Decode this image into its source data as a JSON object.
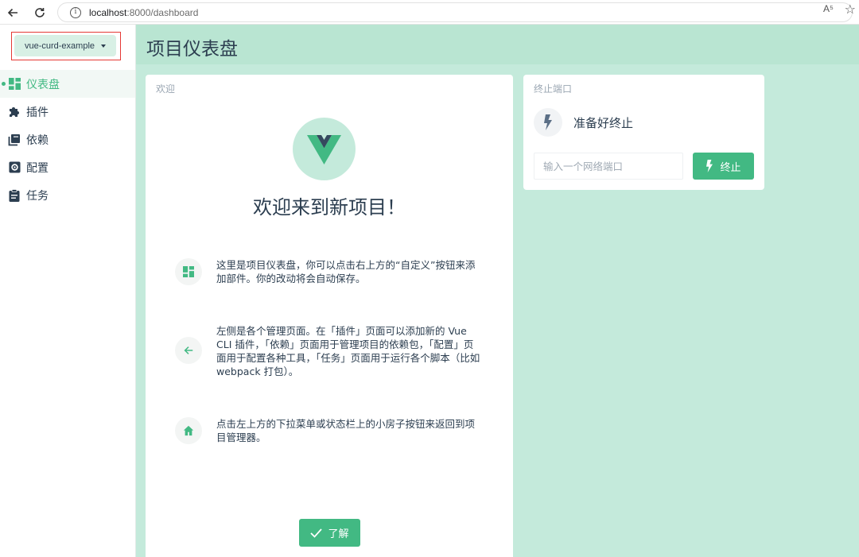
{
  "browser": {
    "url_host": "localhost",
    "url_rest": ":8000/dashboard",
    "read_aloud_label": "A⁵"
  },
  "sidebar": {
    "project_name": "vue-curd-example",
    "items": [
      {
        "label": "仪表盘",
        "icon": "dashboard-icon",
        "active": true
      },
      {
        "label": "插件",
        "icon": "puzzle-icon",
        "active": false
      },
      {
        "label": "依赖",
        "icon": "library-icon",
        "active": false
      },
      {
        "label": "配置",
        "icon": "settings-box-icon",
        "active": false
      },
      {
        "label": "任务",
        "icon": "clipboard-icon",
        "active": false
      }
    ]
  },
  "header": {
    "title": "项目仪表盘"
  },
  "welcome": {
    "card_title": "欢迎",
    "heading": "欢迎来到新项目！",
    "tips": [
      {
        "icon": "dashboard-icon",
        "text": "这里是项目仪表盘，你可以点击右上方的“自定义”按钮来添加部件。你的改动将会自动保存。"
      },
      {
        "icon": "arrow-left-icon",
        "text": "左侧是各个管理页面。在「插件」页面可以添加新的 Vue CLI 插件，「依赖」页面用于管理项目的依赖包，「配置」页面用于配置各种工具，「任务」页面用于运行各个脚本（比如 webpack 打包）。"
      },
      {
        "icon": "home-icon",
        "text": "点击左上方的下拉菜单或状态栏上的小房子按钮来返回到项目管理器。"
      }
    ],
    "ok_label": "了解"
  },
  "kill_port": {
    "card_title": "终止端口",
    "status": "准备好终止",
    "input_placeholder": "输入一个网络端口",
    "input_value": "",
    "button_label": "终止"
  },
  "colors": {
    "accent": "#42b983",
    "main_bg": "#c4eadb",
    "header_bg": "#b9e5d2",
    "highlight_border": "#e53935"
  }
}
